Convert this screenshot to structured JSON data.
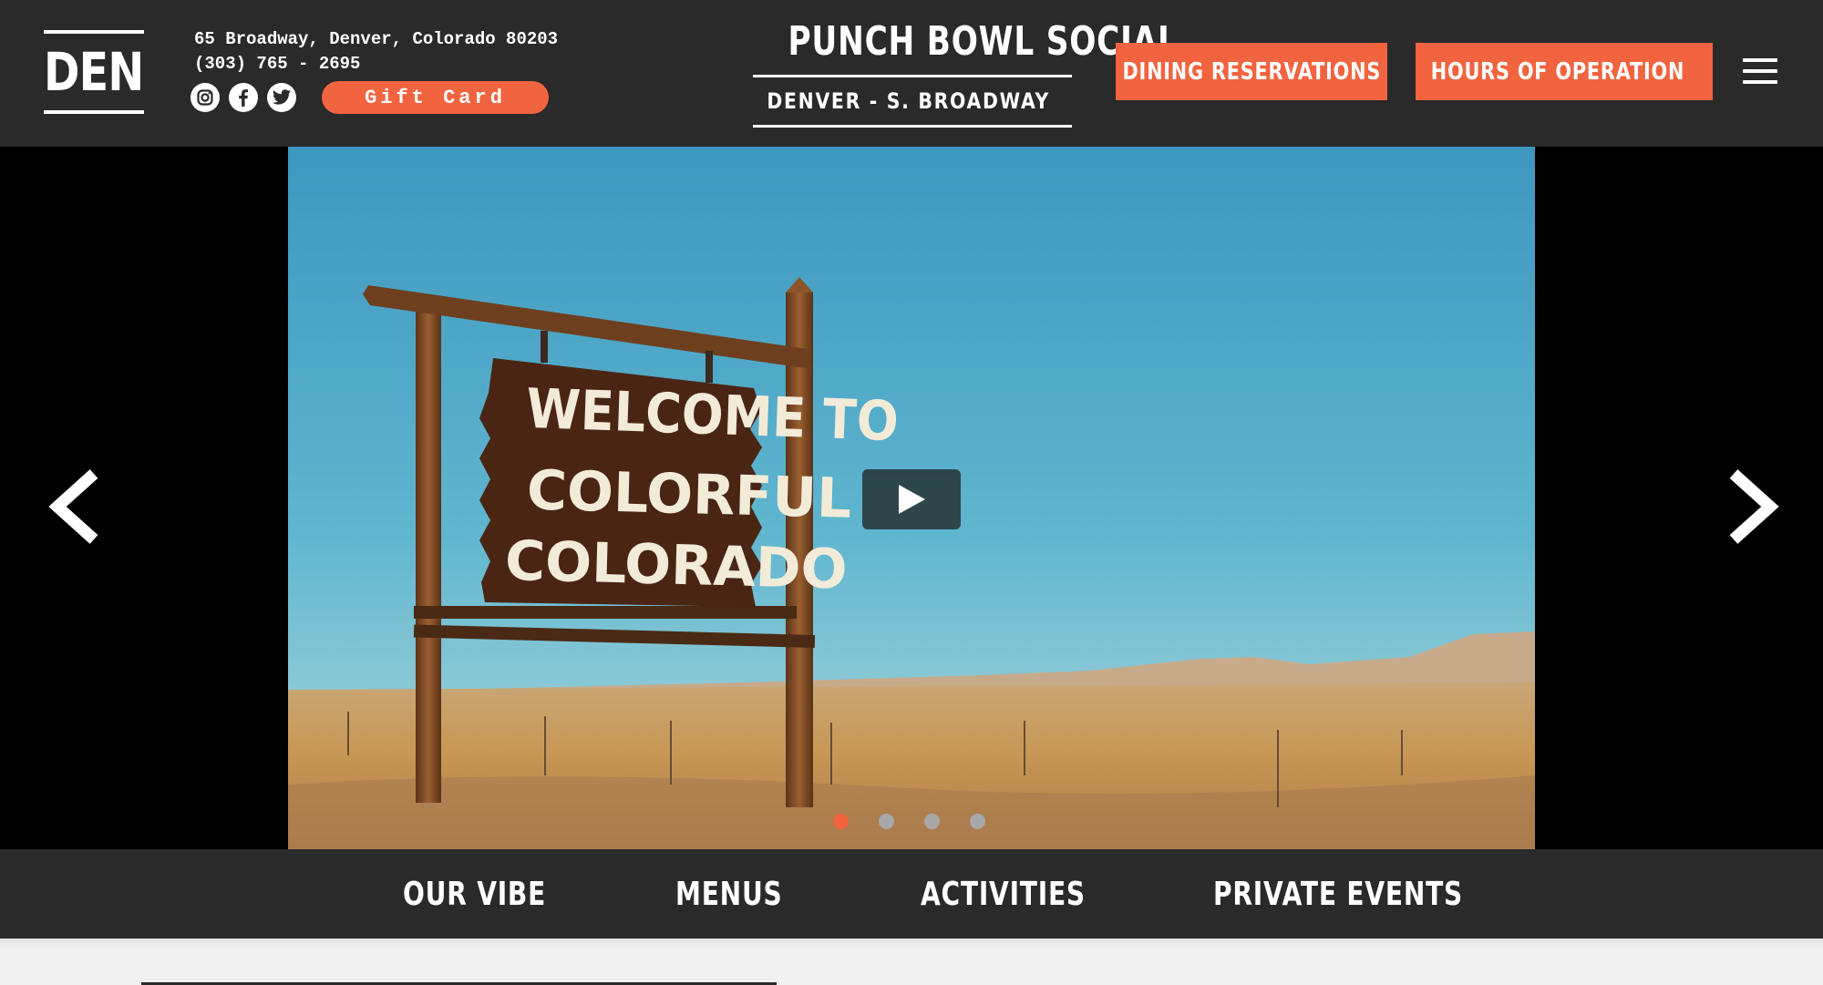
{
  "logo": {
    "text": "DEN"
  },
  "contact": {
    "address": "65 Broadway, Denver, Colorado 80203",
    "phone": "(303) 765 - 2695"
  },
  "social": [
    "instagram-icon",
    "facebook-icon",
    "twitter-icon"
  ],
  "gift_card": {
    "label": "Gift Card"
  },
  "brand": {
    "title": "PUNCH BOWL SOCIAL",
    "location": "DENVER - S. BROADWAY"
  },
  "buttons": {
    "dining": "DINING RESERVATIONS",
    "hours": "HOURS OF OPERATION"
  },
  "hero": {
    "sign_lines": [
      "WELCOME TO",
      "COLORFUL",
      "COLORADO"
    ],
    "slides": 4,
    "active_slide": 1
  },
  "nav": {
    "items": [
      {
        "label": "OUR VIBE"
      },
      {
        "label": "MENUS"
      },
      {
        "label": "ACTIVITIES"
      },
      {
        "label": "PRIVATE EVENTS"
      }
    ]
  },
  "colors": {
    "accent": "#f2643f",
    "header_bg": "#2a2a2a",
    "sky": "#4aa5c2",
    "desert": "#c99a5e"
  }
}
